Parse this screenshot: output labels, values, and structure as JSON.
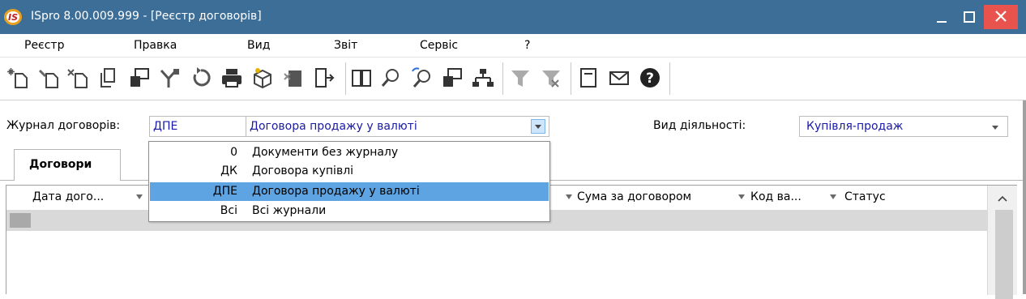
{
  "window": {
    "title": "ISpro 8.00.009.999 - [Реєстр договорів]",
    "controls": {
      "minimize": "_",
      "maximize": "□",
      "close": "✕"
    }
  },
  "menu": {
    "items": [
      "Реєстр",
      "Правка",
      "Вид",
      "Звіт",
      "Сервіс",
      "?"
    ]
  },
  "toolbar": {
    "icons": [
      "add-new-icon",
      "copy-record-icon",
      "delete-record-icon",
      "duplicate-icon",
      "edit-document-icon",
      "merge-icon",
      "refresh-icon",
      "print-icon",
      "package-icon",
      "export-icon",
      "open-journal-icon",
      "book-icon",
      "search-icon",
      "find-next-icon",
      "document-link-icon",
      "tree-structure-icon",
      "filter-icon",
      "clear-filter-icon",
      "form-icon",
      "mail-icon",
      "help-icon"
    ]
  },
  "filters": {
    "journal_label": "Журнал договорів:",
    "journal_code": "ДПЕ",
    "journal_name": "Договора продажу у валюті",
    "activity_label": "Вид діяльності:",
    "activity_value": "Купівля-продаж"
  },
  "tabs": [
    {
      "label": "Договори",
      "active": true
    }
  ],
  "grid": {
    "columns": [
      "Дата дого...",
      "Сума за договором",
      "Код ва...",
      "Статус"
    ],
    "rows": []
  },
  "journal_dropdown": {
    "options": [
      {
        "code": "0",
        "name": "Документи без журналу",
        "selected": false
      },
      {
        "code": "ДК",
        "name": "Договора купівлі",
        "selected": false
      },
      {
        "code": "ДПЕ",
        "name": "Договора продажу у валюті",
        "selected": true
      },
      {
        "code": "Всі",
        "name": "Всі журнали",
        "selected": false
      }
    ]
  },
  "colors": {
    "titlebar": "#3c6e98",
    "close_button": "#e8544d",
    "selection": "#5ea4e3",
    "field_text": "#1a1aa6"
  }
}
